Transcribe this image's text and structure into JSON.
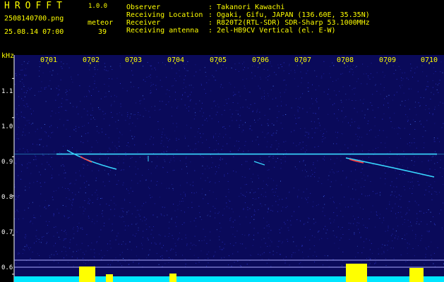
{
  "header": {
    "title": "HROFFT",
    "version": "1.0.0",
    "filename": "2508140700.png",
    "datetime": "25.08.14 07:00",
    "meteor_label": "meteor",
    "meteor_count": "39"
  },
  "info": {
    "rows": [
      {
        "key": "Observer",
        "value": "Takanori Kawachi"
      },
      {
        "key": "Receiving Location",
        "value": "Ogaki, Gifu, JAPAN (136.60E, 35.35N)"
      },
      {
        "key": "Receiver",
        "value": "R820T2(RTL-SDR) SDR-Sharp 53.1000MHz"
      },
      {
        "key": "Receiving antenna",
        "value": "2el-HB9CV Vertical (el. E-W)"
      }
    ]
  },
  "axis": {
    "unit": "kHz",
    "x_ticks": [
      "0701",
      "0702",
      "0703",
      "0704",
      "0705",
      "0706",
      "0707",
      "0708",
      "0709",
      "0710"
    ],
    "y_ticks": [
      "1.1",
      "1.0",
      "0.9",
      "0.8",
      "0.7",
      "0.6"
    ]
  },
  "spectrogram": {
    "frequency_range_khz": [
      0.58,
      1.16
    ],
    "carrier_khz": 0.905,
    "colors": {
      "background": "#0a0a5a",
      "noise": "#2a33c8",
      "trace": "#38d8ff",
      "hot": "#ff4040",
      "label": "#ffff00",
      "amplitude": "#ffff00",
      "amplitude_base": "#00e6ff"
    }
  }
}
